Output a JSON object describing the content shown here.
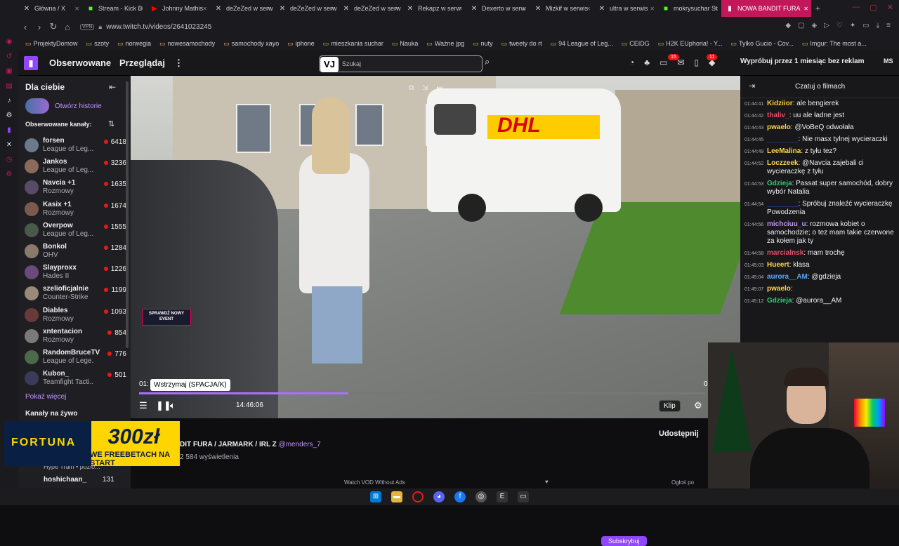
{
  "browser": {
    "tabs": [
      {
        "label": "Główna / X",
        "icon": "x-icon"
      },
      {
        "label": "Stream - Kick D",
        "icon": "kick-icon"
      },
      {
        "label": "Johnny Mathis",
        "icon": "youtube-icon"
      },
      {
        "label": "deZeZed w serw",
        "icon": "x-icon"
      },
      {
        "label": "deZeZed w serw",
        "icon": "x-icon"
      },
      {
        "label": "deZeZed w serw",
        "icon": "x-icon"
      },
      {
        "label": "Rekapz w serw",
        "icon": "x-icon"
      },
      {
        "label": "Dexerto w serw",
        "icon": "x-icon"
      },
      {
        "label": "Mizkif w serwis",
        "icon": "x-icon"
      },
      {
        "label": "ultra w serwis",
        "icon": "x-icon"
      },
      {
        "label": "mokrysuchar St",
        "icon": "kick-icon"
      },
      {
        "label": "NOWA BANDIT FURA",
        "icon": "twitch-icon"
      }
    ],
    "vpn": "VPN",
    "url": "www.twitch.tv/videos/2641023245",
    "bookmarks": [
      "ProjektyDomow",
      "szoty",
      "norwegia",
      "nowesamochody",
      "samochody xayo",
      "iphone",
      "mieszkania suchar",
      "Nauka",
      "Ważne jpg",
      "nuty",
      "tweety do rt",
      "94 League of Leg...",
      "CEIDG",
      "H2K EUphoria! - Y...",
      "Tylko Gucio - Cov...",
      "Imgur: The most a..."
    ]
  },
  "twitch": {
    "nav_followed": "Obserwowane",
    "nav_browse": "Przeglądaj",
    "search_placeholder": "Szukaj",
    "search_overlay": "VJ",
    "badge_inbox": "15",
    "badge_notif": "11",
    "promo": "Wypróbuj przez 1 miesiąc bez reklam",
    "avatar": "MS"
  },
  "sidebar": {
    "title": "Dla ciebie",
    "history_label": "Otwórz historie",
    "followed_label": "Obserwowane kanały:",
    "channels": [
      {
        "name": "forsen",
        "game": "League of Leg...",
        "viewers": "6418"
      },
      {
        "name": "Jankos",
        "game": "League of Leg...",
        "viewers": "3236"
      },
      {
        "name": "Navcia +1",
        "game": "Rozmowy",
        "viewers": "1635"
      },
      {
        "name": "Kasix +1",
        "game": "Rozmowy",
        "viewers": "1674"
      },
      {
        "name": "Overpow",
        "game": "League of Leg...",
        "viewers": "1555"
      },
      {
        "name": "Bonkol",
        "game": "OHV",
        "viewers": "1284"
      },
      {
        "name": "Slayproxx",
        "game": "Hades II",
        "viewers": "1226"
      },
      {
        "name": "szelioficjalnie",
        "game": "Counter-Strike",
        "viewers": "1199"
      },
      {
        "name": "Diables",
        "game": "Rozmowy",
        "viewers": "1093"
      },
      {
        "name": "xntentacion",
        "game": "Rozmowy",
        "viewers": "854"
      },
      {
        "name": "RandomBruceTV",
        "game": "League of Lege...",
        "viewers": "776"
      },
      {
        "name": "Kubon_",
        "game": "Teamfight Tacti...",
        "viewers": "501"
      }
    ],
    "show_more": "Pokaż więcej",
    "live_label": "Kanały na żywo",
    "hype": "Hype Train • pozio...",
    "hosh_name": "hoshichaan_",
    "hosh_viewers": "131"
  },
  "video": {
    "event_banner": "SPRAWDŹ NOWY EVENT",
    "van_text": "DHL",
    "tooltip": "Wstrzymaj (SPACJA/K)",
    "time_left": "01:",
    "time_right": "0",
    "duration": "14:46:06",
    "progress": 0.37,
    "clip": "Klip"
  },
  "info": {
    "title": "DIT FURA / JARMARK / IRL Z",
    "mention": "@menders_7",
    "views": "2 584 wyświetlenia",
    "share": "Udostępnij",
    "vod": "Watch VOD Without Ads",
    "subscribe": "Subskrybuj",
    "gift": "Ogłoś po"
  },
  "ad": {
    "brand": "FORTUNA",
    "amount": "300zł",
    "slogan": "WE FREEBETACH NA START"
  },
  "chat": {
    "title": "Czatuj o filmach",
    "messages": [
      {
        "ts": "01:44:41",
        "user": "Kidziior",
        "color": "#ffcc33",
        "text": "ale bengierek"
      },
      {
        "ts": "01:44:42",
        "user": "thaliv_",
        "color": "#e74c6a",
        "text": "uu ale ładne jest"
      },
      {
        "ts": "01:44:43",
        "user": "pwaelo",
        "color": "#ffd54a",
        "text": "@VoBeQ odwołała"
      },
      {
        "ts": "01:44:45",
        "user": "________",
        "color": "#2e6bff",
        "text": "Nie masx tylnej wycieraczki"
      },
      {
        "ts": "01:44:49",
        "user": "LeeMalina",
        "color": "#ffd54a",
        "text": "z tyłu tez?"
      },
      {
        "ts": "01:44:52",
        "user": "Loczzeek",
        "color": "#ffd54a",
        "text": "@Navcia zajebali ci wycieraczkę z tyłu"
      },
      {
        "ts": "01:44:53",
        "user": "Gdzieja",
        "color": "#2ecc71",
        "text": "Passat super samochód, dobry wybór Natalia"
      },
      {
        "ts": "01:44:54",
        "user": "________",
        "color": "#2e6bff",
        "text": "Spróbuj znaleźć wycieraczkę Powodzenia"
      },
      {
        "ts": "01:44:56",
        "user": "michciuu_u",
        "color": "#bf94ff",
        "text": "rozmowa kobiet o samochodzie; o tez mam takie czerwone za kołem jak ty"
      },
      {
        "ts": "01:44:58",
        "user": "marcialnsk",
        "color": "#e74c6a",
        "text": "mam trochę"
      },
      {
        "ts": "01:45:03",
        "user": "Hueert",
        "color": "#ffd54a",
        "text": "klasa"
      },
      {
        "ts": "01:45:04",
        "user": "aurora__AM",
        "color": "#5aa9ff",
        "text": "@gdzieja"
      },
      {
        "ts": "01:45:07",
        "user": "pwaelo",
        "color": "#ffd54a",
        "text": ""
      },
      {
        "ts": "01:45:12",
        "user": "Gdzieja",
        "color": "#2ecc71",
        "text": "@aurora__AM"
      }
    ]
  },
  "colors": {
    "accent": "#9147ff",
    "live": "#e91916",
    "active_tab": "#c2185b"
  }
}
